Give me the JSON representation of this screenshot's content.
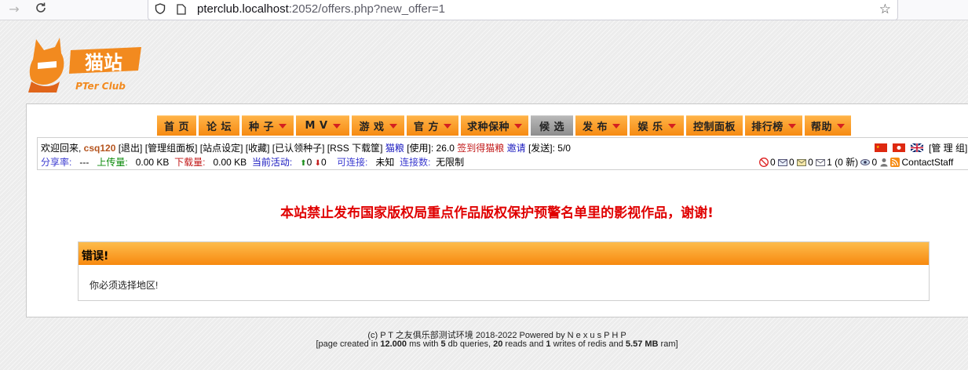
{
  "browser": {
    "url_host": "pterclub.localhost",
    "url_rest": ":2052/offers.php?new_offer=1"
  },
  "logo": {
    "cn": "猫站",
    "en": "PTer Club"
  },
  "menu": [
    {
      "label": "首 页",
      "dropdown": false,
      "selected": false
    },
    {
      "label": "论 坛",
      "dropdown": false,
      "selected": false
    },
    {
      "label": "种 子",
      "dropdown": true,
      "selected": false
    },
    {
      "label": "M V",
      "dropdown": true,
      "selected": false
    },
    {
      "label": "游 戏",
      "dropdown": true,
      "selected": false
    },
    {
      "label": "官 方",
      "dropdown": true,
      "selected": false
    },
    {
      "label": "求种保种",
      "dropdown": true,
      "selected": false
    },
    {
      "label": "候 选",
      "dropdown": false,
      "selected": true
    },
    {
      "label": "发 布",
      "dropdown": true,
      "selected": false
    },
    {
      "label": "娱 乐",
      "dropdown": true,
      "selected": false
    },
    {
      "label": "控制面板",
      "dropdown": false,
      "selected": false
    },
    {
      "label": "排行榜",
      "dropdown": true,
      "selected": false
    },
    {
      "label": "帮助",
      "dropdown": true,
      "selected": false
    }
  ],
  "userbar": {
    "welcome": "欢迎回来, ",
    "username": "csq120",
    "logout": "[退出]",
    "admin_panel": "[管理组面板]",
    "site_settings": "[站点设定]",
    "favorites": "[收藏]",
    "claimed": "[已认领种子]",
    "rss": "[RSS 下载筐]",
    "bonus_label": "猫粮",
    "usage_label": "[使用]: 26.0",
    "checkin": "签到得猫粮",
    "invite": "邀请",
    "sent": "[发送]: 5/0",
    "staff_label": "[管 理 组]"
  },
  "statsbar": {
    "ratio_label": "分享率:",
    "ratio_value": "---",
    "upload_label": "上传量:",
    "upload_value": "0.00 KB",
    "download_label": "下载量:",
    "download_value": "0.00 KB",
    "active_label": "当前活动:",
    "seeding": "0",
    "leeching": "0",
    "connectable_label": "可连接:",
    "connectable_value": "未知",
    "connections_label": "连接数:",
    "connections_value": "无限制",
    "c1": "0",
    "c2": "0",
    "c3": "0",
    "c4": "1 (0 新)",
    "c5": "0",
    "contact": "ContactStaff"
  },
  "notice": "本站禁止发布国家版权局重点作品版权保护预警名单里的影视作品，谢谢!",
  "error": {
    "title": "错误!",
    "message": "你必须选择地区!"
  },
  "footer": {
    "line1": "(c)  P T 之友俱乐部测试环境 2018-2022 Powered by N e x u s P H P",
    "pre": "[page created in ",
    "ms": "12.000",
    "ms_suffix": " ms with ",
    "queries": "5",
    "queries_suffix": " db queries, ",
    "reads": "20",
    "reads_suffix": " reads and ",
    "writes": "1",
    "writes_suffix": " writes of redis and ",
    "ram": "5.57 MB",
    "ram_suffix": " ram]"
  }
}
